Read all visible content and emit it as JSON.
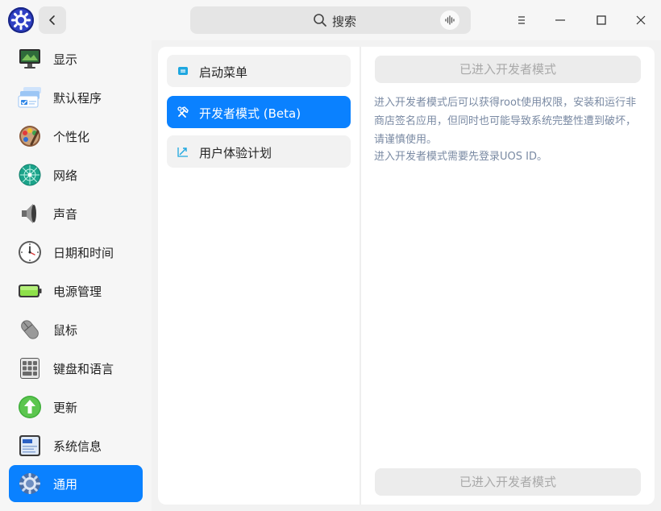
{
  "titlebar": {
    "search_label": "搜索"
  },
  "sidebar": {
    "items": [
      {
        "label": "显示",
        "icon": "display-icon"
      },
      {
        "label": "默认程序",
        "icon": "default-apps-icon"
      },
      {
        "label": "个性化",
        "icon": "personalization-icon"
      },
      {
        "label": "网络",
        "icon": "network-icon"
      },
      {
        "label": "声音",
        "icon": "sound-icon"
      },
      {
        "label": "日期和时间",
        "icon": "clock-icon"
      },
      {
        "label": "电源管理",
        "icon": "battery-icon"
      },
      {
        "label": "鼠标",
        "icon": "mouse-icon"
      },
      {
        "label": "键盘和语言",
        "icon": "keyboard-icon"
      },
      {
        "label": "更新",
        "icon": "update-icon"
      },
      {
        "label": "系统信息",
        "icon": "system-info-icon"
      },
      {
        "label": "通用",
        "icon": "general-icon"
      }
    ],
    "active_index": 11
  },
  "subnav": {
    "items": [
      {
        "label": "启动菜单",
        "icon": "boot-menu-icon"
      },
      {
        "label": "开发者模式 (Beta)",
        "icon": "developer-tools-icon"
      },
      {
        "label": "用户体验计划",
        "icon": "ux-program-icon"
      }
    ],
    "active_index": 1
  },
  "content": {
    "top_button": "已进入开发者模式",
    "description_1": "进入开发者模式后可以获得root使用权限，安装和运行非商店签名应用，但同时也可能导致系统完整性遭到破坏，请谨慎使用。",
    "description_2": "进入开发者模式需要先登录UOS ID。",
    "bottom_button": "已进入开发者模式"
  },
  "colors": {
    "accent": "#0a81ff",
    "description_text": "#7a8aa3",
    "disabled_text": "#a9a9a9"
  }
}
